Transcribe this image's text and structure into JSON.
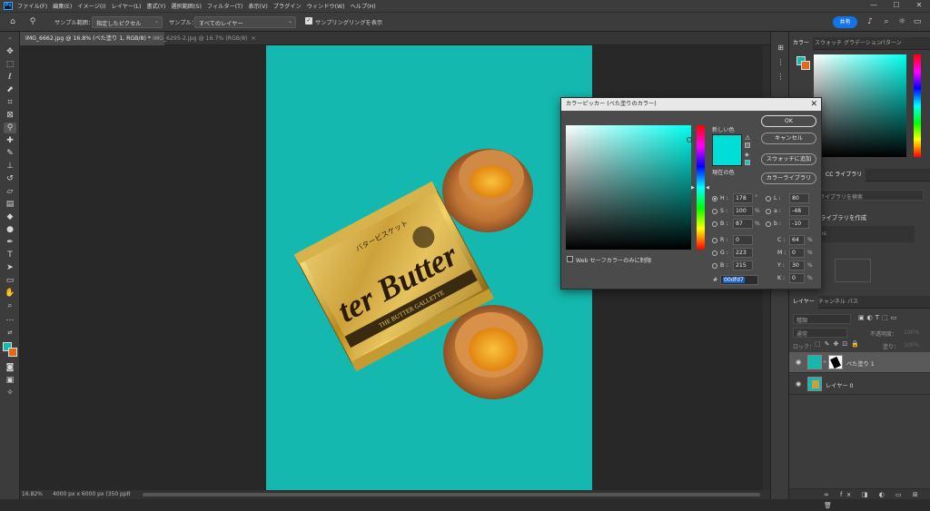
{
  "app": {
    "logo": "Ps"
  },
  "menu": [
    "ファイル(F)",
    "編集(E)",
    "イメージ(I)",
    "レイヤー(L)",
    "書式(Y)",
    "選択範囲(S)",
    "フィルター(T)",
    "表示(V)",
    "プラグイン",
    "ウィンドウ(W)",
    "ヘルプ(H)"
  ],
  "window_controls": {
    "min": "—",
    "max": "☐",
    "close": "✕"
  },
  "options_bar": {
    "sample_size_label": "サンプル範囲：",
    "sample_size_value": "指定したピクセル",
    "sample_label": "サンプル：",
    "sample_value": "すべてのレイヤー",
    "show_ring_label": "サンプリングリングを表示",
    "share_label": "共有"
  },
  "doc_tabs": [
    {
      "title": "IMG_6662.jpg @ 16.8% (べた塗り 1, RGB/8) *",
      "close": "×"
    },
    {
      "title": "IMG_6295-2.jpg @ 16.7% (RGB/8)",
      "close": "×"
    }
  ],
  "status": {
    "zoom": "16.82%",
    "info": "4000 px x 6000 px (350 ppi)",
    "arrow": "›"
  },
  "artwork": {
    "bg_color": "#14b8ae",
    "package_big_text": "ter Butter",
    "package_top_text": "バタービスケット",
    "package_band_text": "THE BUTTER GALLETTE"
  },
  "color_panel": {
    "tabs": [
      "カラー",
      "スウォッチ",
      "グラデーション",
      "パターン"
    ]
  },
  "libraries_panel": {
    "tab": "CC ライブラリ",
    "search_placeholder": "ライブラリを検索",
    "create_label": "ライブラリを作成",
    "item": "es"
  },
  "layers_panel": {
    "tabs": [
      "レイヤー",
      "チャンネル",
      "パス"
    ],
    "search_placeholder": "種類",
    "blend_mode": "通常",
    "opacity_label": "不透明度：",
    "opacity_value": "100%",
    "lock_label": "ロック：",
    "fill_label": "塗り：",
    "fill_value": "100%",
    "layers": [
      {
        "name": "べた塗り 1",
        "selected": true
      },
      {
        "name": "レイヤー 0",
        "selected": false
      }
    ]
  },
  "color_picker": {
    "title": "カラーピッカー (べた塗りのカラー)",
    "new_label": "新しい色",
    "current_label": "現在の色",
    "current_color": "#00dfd7",
    "buttons": {
      "ok": "OK",
      "cancel": "キャンセル",
      "add_swatch": "スウォッチに追加",
      "libraries": "カラーライブラリ"
    },
    "hsb": [
      {
        "label": "H :",
        "value": "178",
        "unit": "°"
      },
      {
        "label": "S :",
        "value": "100",
        "unit": "%"
      },
      {
        "label": "B :",
        "value": "87",
        "unit": "%"
      }
    ],
    "rgb": [
      {
        "label": "R :",
        "value": "0"
      },
      {
        "label": "G :",
        "value": "223"
      },
      {
        "label": "B :",
        "value": "215"
      }
    ],
    "lab": [
      {
        "label": "L :",
        "value": "80"
      },
      {
        "label": "a :",
        "value": "-48"
      },
      {
        "label": "b :",
        "value": "-10"
      }
    ],
    "cmyk": [
      {
        "label": "C :",
        "value": "64",
        "unit": "%"
      },
      {
        "label": "M :",
        "value": "0",
        "unit": "%"
      },
      {
        "label": "Y :",
        "value": "30",
        "unit": "%"
      },
      {
        "label": "K :",
        "value": "0",
        "unit": "%"
      }
    ],
    "web_only_label": "Web セーフカラーのみに制限",
    "hex_label": "#",
    "hex_value": "00dfd7"
  },
  "colors": {
    "accent": "#1473e6",
    "foreground": "#14b8ae",
    "background": "#e06a1a"
  }
}
